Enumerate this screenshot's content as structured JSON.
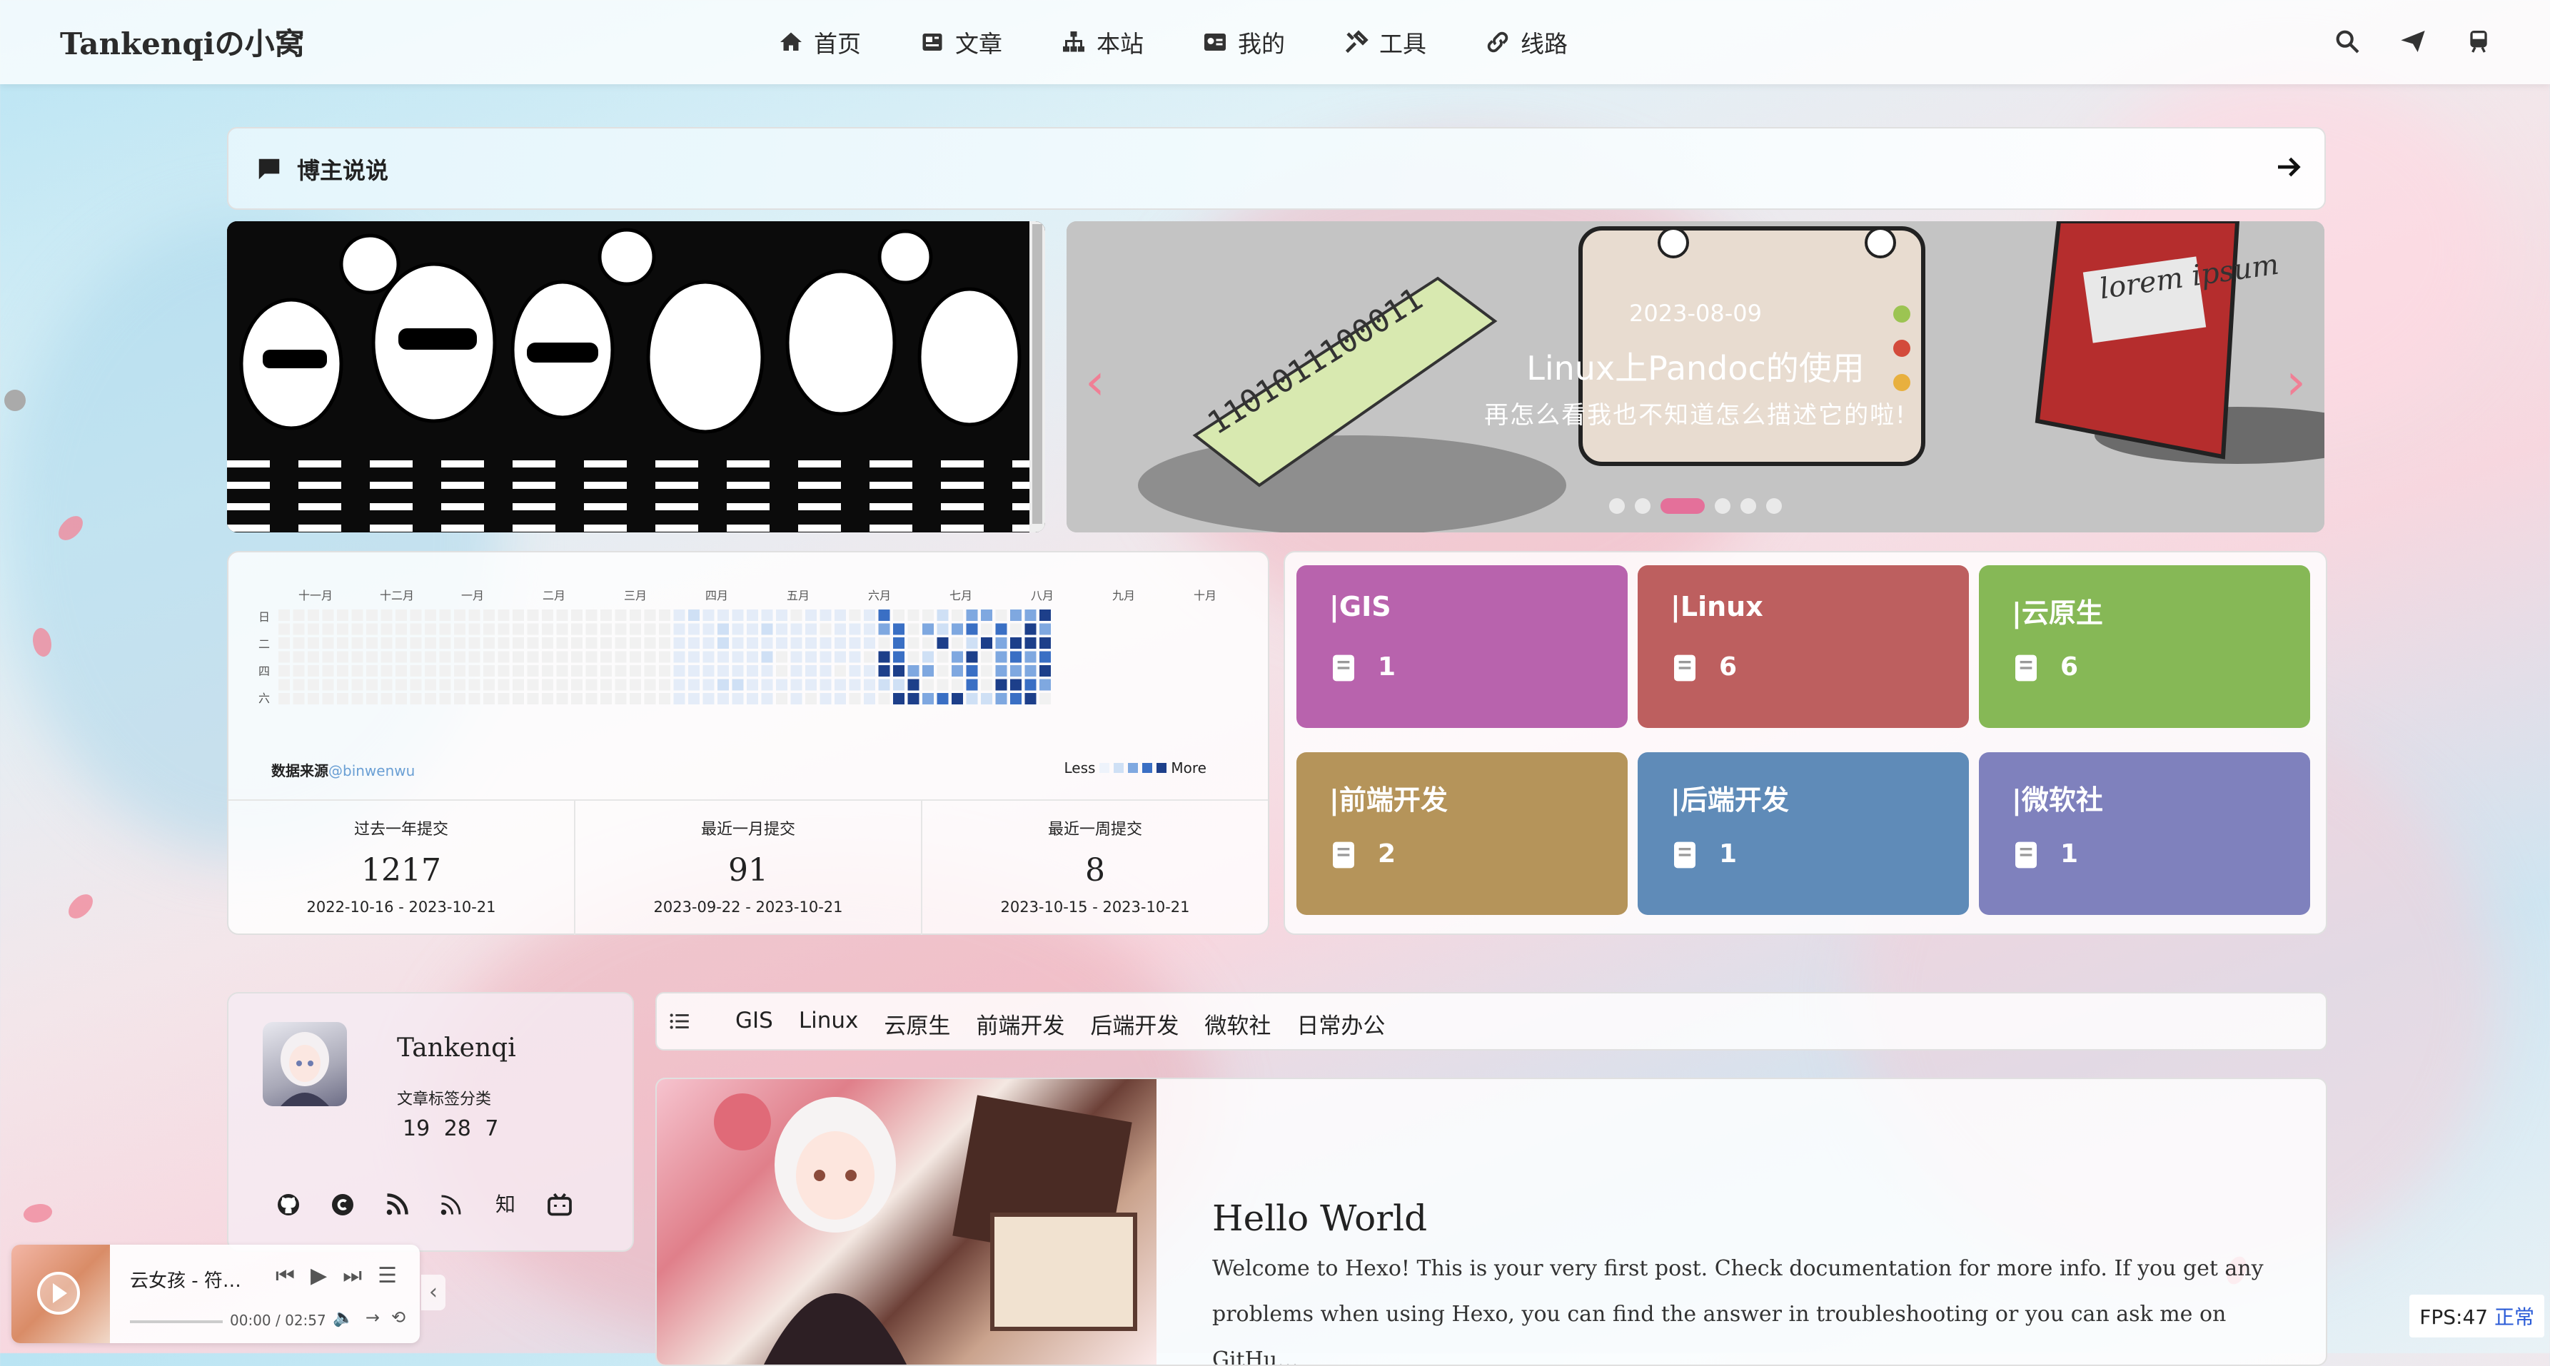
{
  "brand": "Tankenqiの小窝",
  "nav": [
    {
      "label": "首页",
      "icon": "home-icon"
    },
    {
      "label": "文章",
      "icon": "newspaper-icon"
    },
    {
      "label": "本站",
      "icon": "sitemap-icon"
    },
    {
      "label": "我的",
      "icon": "id-card-icon"
    },
    {
      "label": "工具",
      "icon": "tools-icon"
    },
    {
      "label": "线路",
      "icon": "link-icon"
    }
  ],
  "talk": {
    "label": "博主说说"
  },
  "slider": {
    "date": "2023-08-09",
    "title": "Linux上Pandoc的使用",
    "desc": "再怎么看我也不知道怎么描述它的啦!",
    "book_text": "lorem ipsum",
    "binary_text": "1101011100011",
    "dots": 6,
    "active_dot": 2
  },
  "contrib": {
    "months": [
      "十一月",
      "十二月",
      "一月",
      "二月",
      "三月",
      "四月",
      "五月",
      "六月",
      "七月",
      "八月",
      "九月",
      "十月"
    ],
    "weekdays": [
      "日",
      "二",
      "四",
      "六"
    ],
    "source_label": "数据来源",
    "source_link": "@binwenwu",
    "legend_less": "Less",
    "legend_more": "More",
    "stats": [
      {
        "label": "过去一年提交",
        "value": "1217",
        "range": "2022-10-16 - 2023-10-21"
      },
      {
        "label": "最近一月提交",
        "value": "91",
        "range": "2023-09-22 - 2023-10-21"
      },
      {
        "label": "最近一周提交",
        "value": "8",
        "range": "2023-10-15 - 2023-10-21"
      }
    ]
  },
  "categories": [
    {
      "name": "|GIS",
      "count": "1",
      "color": "#b863ad"
    },
    {
      "name": "|Linux",
      "count": "6",
      "color": "#bd5f5f"
    },
    {
      "name": "|云原生",
      "count": "6",
      "color": "#86b856"
    },
    {
      "name": "|前端开发",
      "count": "2",
      "color": "#b5945a"
    },
    {
      "name": "|后端开发",
      "count": "1",
      "color": "#5f8bb8"
    },
    {
      "name": "|微软社",
      "count": "1",
      "color": "#7f81bd"
    }
  ],
  "profile": {
    "name": "Tankenqi",
    "sub": "文章标签分类",
    "nums": "19 28 7",
    "social": [
      "github-icon",
      "copyright-icon",
      "rss-icon",
      "rss-alt-icon",
      "zhihu-icon",
      "bilibili-icon"
    ],
    "zhihu": "知"
  },
  "tags": [
    "GIS",
    "Linux",
    "云原生",
    "前端开发",
    "后端开发",
    "微软社",
    "日常办公"
  ],
  "post": {
    "title": "Hello World",
    "text": "Welcome to Hexo! This is your very first post. Check documentation for more info. If you get any problems when using Hexo, you can find the answer in troubleshooting or you can ask me on GitHu…"
  },
  "player": {
    "song": "云女孩 - 符…",
    "time_current": "00:00",
    "time_sep": "/",
    "time_total": "02:57"
  },
  "fps": {
    "label": "FPS:47",
    "status": "正常"
  }
}
